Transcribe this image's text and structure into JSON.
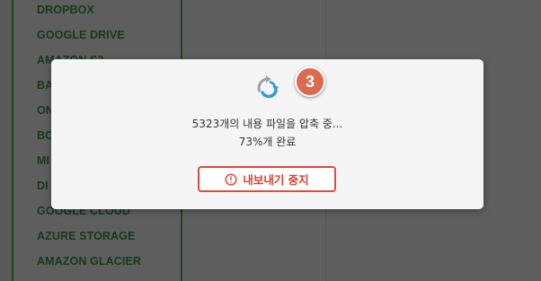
{
  "sidebar": {
    "items": [
      "DROPBOX",
      "GOOGLE DRIVE",
      "AMAZON S3",
      "BA",
      "ON",
      "BO",
      "MI",
      "DI",
      "GOOGLE CLOUD",
      "AZURE STORAGE",
      "AMAZON GLACIER"
    ]
  },
  "modal": {
    "step_badge": "3",
    "status_line1": "5323개의 내용 파일을 압축 중...",
    "status_line2": "73%개 완료",
    "progress_percent": 73,
    "stop_button_label": "내보내기 중지",
    "icons": {
      "spinner": "refresh-icon",
      "stop": "alert-circle-icon"
    },
    "colors": {
      "accent": "#de4b3c",
      "badge": "#dc6a4f",
      "spinner_blue": "#2c9be0"
    }
  }
}
